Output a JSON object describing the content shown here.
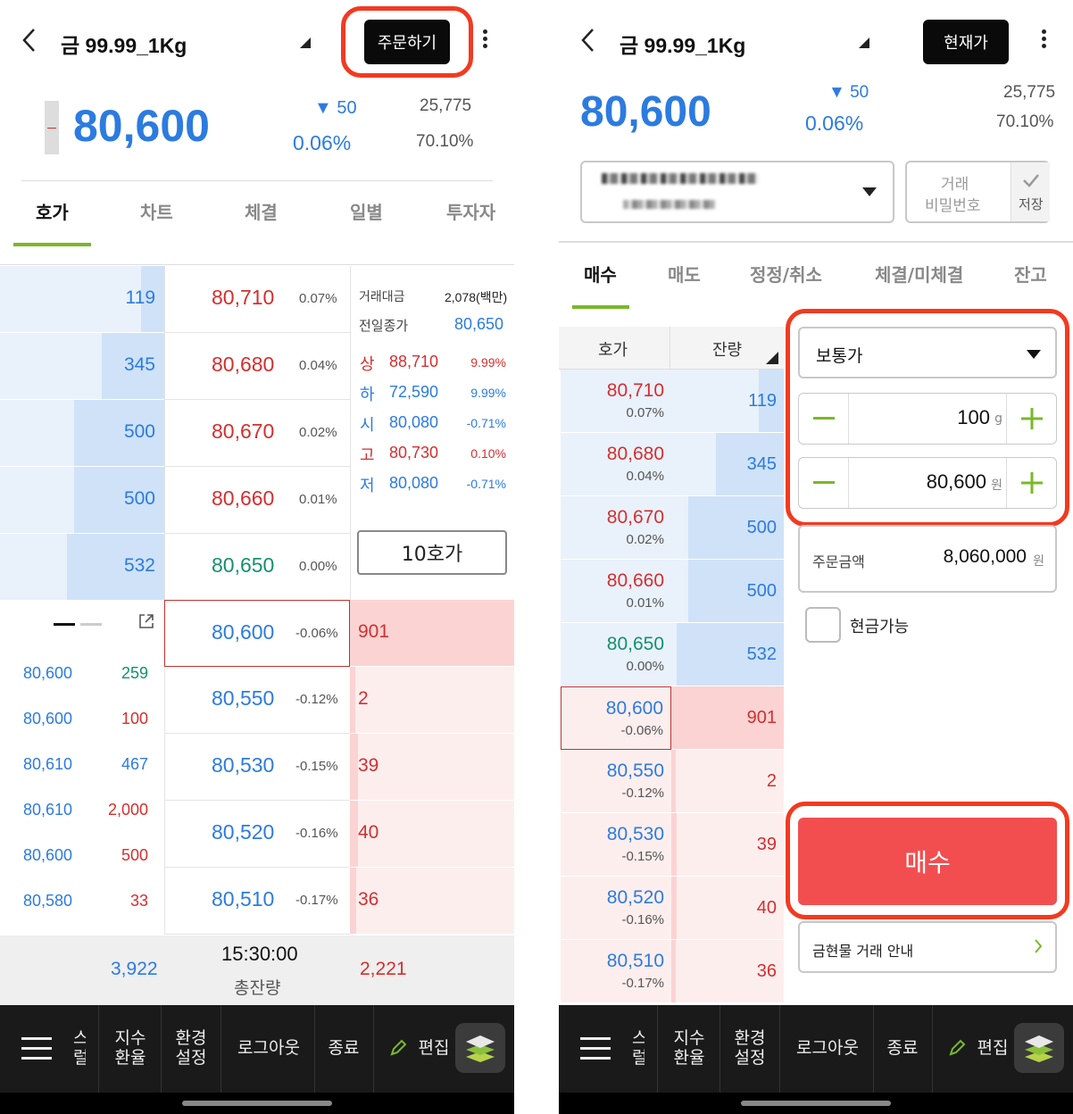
{
  "left": {
    "title": "금 99.99_1Kg",
    "order_button": "주문하기",
    "price": "80,600",
    "change": "▼ 50",
    "change_pct": "0.06%",
    "volume": "25,775",
    "ratio": "70.10%",
    "tabs": [
      "호가",
      "차트",
      "체결",
      "일별",
      "투자자"
    ],
    "asks": [
      {
        "qty": "119",
        "price": "80,710",
        "pct": "0.07%",
        "bar": 0.14,
        "color": "red"
      },
      {
        "qty": "345",
        "price": "80,680",
        "pct": "0.04%",
        "bar": 0.38,
        "color": "red"
      },
      {
        "qty": "500",
        "price": "80,670",
        "pct": "0.02%",
        "bar": 0.55,
        "color": "red"
      },
      {
        "qty": "500",
        "price": "80,660",
        "pct": "0.01%",
        "bar": 0.55,
        "color": "red"
      },
      {
        "qty": "532",
        "price": "80,650",
        "pct": "0.00%",
        "bar": 0.59,
        "color": "green"
      }
    ],
    "info": {
      "amount_label": "거래대금",
      "amount_value": "2,078(백만)",
      "prev_label": "전일종가",
      "prev_value": "80,650",
      "rows": [
        {
          "label": "상",
          "value": "88,710",
          "pct": "9.99%",
          "color": "red"
        },
        {
          "label": "하",
          "value": "72,590",
          "pct": "9.99%",
          "color": "blue"
        },
        {
          "label": "시",
          "value": "80,080",
          "pct": "-0.71%",
          "color": "blue"
        },
        {
          "label": "고",
          "value": "80,730",
          "pct": "0.10%",
          "color": "red"
        },
        {
          "label": "저",
          "value": "80,080",
          "pct": "-0.71%",
          "color": "blue"
        }
      ],
      "tenhoga_button": "10호가"
    },
    "bids": [
      {
        "price": "80,600",
        "pct": "-0.06%",
        "qty": "901",
        "bar": 1.0
      },
      {
        "price": "80,550",
        "pct": "-0.12%",
        "qty": "2",
        "bar": 0.03
      },
      {
        "price": "80,530",
        "pct": "-0.15%",
        "qty": "39",
        "bar": 0.05
      },
      {
        "price": "80,520",
        "pct": "-0.16%",
        "qty": "40",
        "bar": 0.05
      },
      {
        "price": "80,510",
        "pct": "-0.17%",
        "qty": "36",
        "bar": 0.04
      }
    ],
    "trades": [
      {
        "price": "80,600",
        "qty": "259",
        "color": "green"
      },
      {
        "price": "80,600",
        "qty": "100",
        "color": "red"
      },
      {
        "price": "80,610",
        "qty": "467",
        "color": "blue"
      },
      {
        "price": "80,610",
        "qty": "2,000",
        "color": "red"
      },
      {
        "price": "80,600",
        "qty": "500",
        "color": "red"
      },
      {
        "price": "80,580",
        "qty": "33",
        "color": "red"
      }
    ],
    "total_ask": "3,922",
    "time": "15:30:00",
    "total_label": "총잔량",
    "total_bid": "2,221"
  },
  "right": {
    "title": "금 99.99_1Kg",
    "current_button": "현재가",
    "price": "80,600",
    "change": "▼ 50",
    "change_pct": "0.06%",
    "volume": "25,775",
    "ratio": "70.10%",
    "pw_label_1": "거래",
    "pw_label_2": "비밀번호",
    "save_label": "저장",
    "tabs": [
      "매수",
      "매도",
      "정정/취소",
      "체결/미체결",
      "잔고"
    ],
    "col_price": "호가",
    "col_qty": "잔량",
    "asks": [
      {
        "price": "80,710",
        "pct": "0.07%",
        "qty": "119",
        "bar": 0.22,
        "color": "red"
      },
      {
        "price": "80,680",
        "pct": "0.04%",
        "qty": "345",
        "bar": 0.6,
        "color": "red"
      },
      {
        "price": "80,670",
        "pct": "0.02%",
        "qty": "500",
        "bar": 0.85,
        "color": "red"
      },
      {
        "price": "80,660",
        "pct": "0.01%",
        "qty": "500",
        "bar": 0.85,
        "color": "red"
      },
      {
        "price": "80,650",
        "pct": "0.00%",
        "qty": "532",
        "bar": 0.95,
        "color": "green"
      }
    ],
    "bids": [
      {
        "price": "80,600",
        "pct": "-0.06%",
        "qty": "901",
        "bar": 1.0
      },
      {
        "price": "80,550",
        "pct": "-0.12%",
        "qty": "2",
        "bar": 0.04
      },
      {
        "price": "80,530",
        "pct": "-0.15%",
        "qty": "39",
        "bar": 0.05
      },
      {
        "price": "80,520",
        "pct": "-0.16%",
        "qty": "40",
        "bar": 0.05
      },
      {
        "price": "80,510",
        "pct": "-0.17%",
        "qty": "36",
        "bar": 0.04
      }
    ],
    "order_type": "보통가",
    "qty_value": "100",
    "qty_unit": "g",
    "price_value": "80,600",
    "price_unit": "원",
    "amount_label": "주문금액",
    "amount_value": "8,060,000",
    "amount_unit": "원",
    "cash_label": "현금가능",
    "buy_button": "매수",
    "guide_label": "금현물 거래 안내"
  },
  "footer": {
    "partial_1": "스",
    "partial_2": "럴",
    "item_1a": "지수",
    "item_1b": "환율",
    "item_2a": "환경",
    "item_2b": "설정",
    "logout": "로그아웃",
    "exit": "종료",
    "edit": "편집"
  },
  "colors": {
    "accent_green": "#7ab829",
    "up_red": "#d42f2f",
    "down_blue": "#2c7be0",
    "highlight_red": "#f23a21",
    "buy_button": "#f24e50"
  }
}
